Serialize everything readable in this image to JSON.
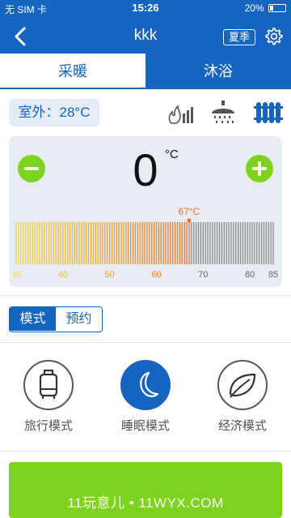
{
  "status_bar": {
    "carrier": "无 SIM 卡",
    "time": "15:26",
    "battery": "20%",
    "battery_level": 0.2
  },
  "nav": {
    "title": "kkk",
    "season": "夏季",
    "back_icon": "chevron-left-icon",
    "settings_icon": "gear-icon"
  },
  "tabs": {
    "heating": "采暖",
    "bathing": "沐浴"
  },
  "outdoor": {
    "label": "室外：28°C"
  },
  "temperature": {
    "value": "0",
    "unit": "°C"
  },
  "gauge": {
    "min": 30,
    "max": 85,
    "current_label": "67°C",
    "current": 67,
    "ticks": [
      "30",
      "40",
      "50",
      "60",
      "70",
      "80",
      "85"
    ]
  },
  "segment": {
    "mode": "模式",
    "booking": "预约"
  },
  "modes": {
    "travel": "旅行模式",
    "sleep": "睡眠模式",
    "eco": "经济模式"
  },
  "watermark": "11玩意儿 • 11WYX.COM",
  "colors": {
    "primary": "#1565c0",
    "accent_green": "#7ed321",
    "gauge_low": "#f5d547",
    "gauge_high": "#e8702a",
    "gauge_off": "#888888"
  }
}
